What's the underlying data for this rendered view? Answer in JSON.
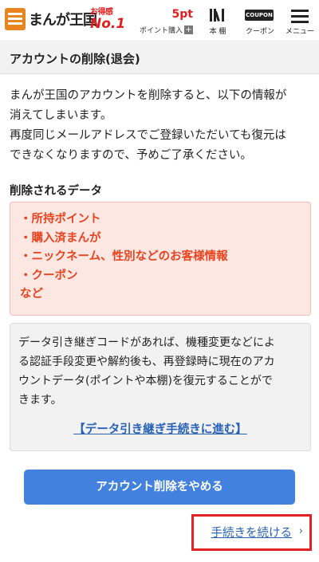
{
  "header": {
    "logo_text": "まんが王国",
    "badge_small": "お得感",
    "badge_no1": "No.1",
    "points": "5pt",
    "buy_points": "ポイント購入",
    "buy_plus": "+",
    "shelf_label": "本 棚",
    "coupon_icon_text": "COUPON",
    "coupon_label": "クーポン",
    "menu_label": "メニュー",
    "brand_color": "#e8851f",
    "accent_red": "#e02020"
  },
  "page": {
    "title": "アカウントの削除(退会)",
    "intro_lines": [
      "まんが王国のアカウントを削除すると、以下の情報が",
      "消えてしまいます。",
      "再度同じメールアドレスでご登録いただいても復元は",
      "できなくなりますので、予めご了承ください。"
    ],
    "deleted_heading": "削除されるデータ",
    "deleted_items": [
      "・所持ポイント",
      "・購入済まんが",
      "・ニックネーム、性別などのお客様情報",
      "・クーポン",
      "など"
    ],
    "transfer_lines": [
      "データ引き継ぎコードがあれば、機種変更などによ",
      "る認証手段変更や解約後も、再登録時に現在のアカ",
      "ウントデータ(ポイントや本棚)を復元することがで",
      "きます。"
    ],
    "transfer_link": "【データ引き継ぎ手続きに進む】",
    "cancel_button": "アカウント削除をやめる",
    "continue_link": "手続きを続ける",
    "continue_chevron": "›",
    "button_color": "#4281dd",
    "link_color": "#2762b7"
  }
}
